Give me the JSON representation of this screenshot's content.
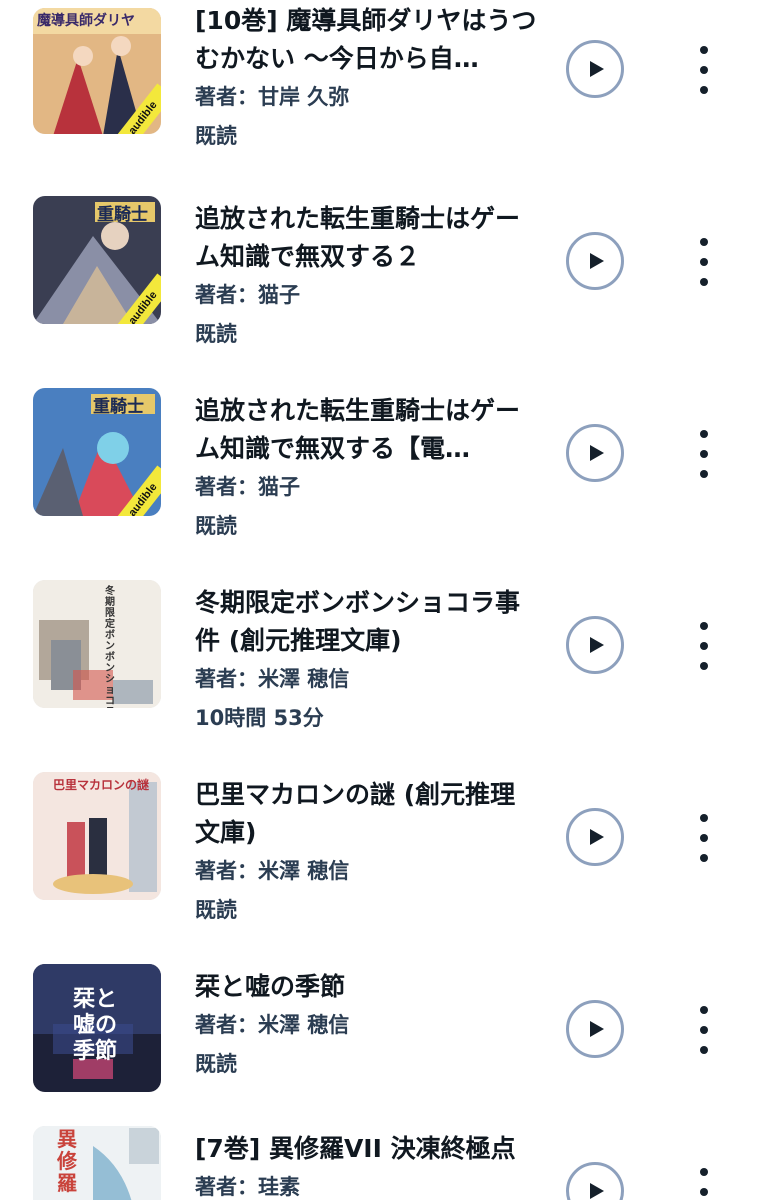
{
  "library": {
    "items": [
      {
        "title": "[10巻] 魔導具師ダリヤはうつむかない ～今日から自…",
        "author": "著者：甘岸 久弥",
        "status": "既読",
        "cover_badge": "audible",
        "cover_title": "魔導具師ダリヤ",
        "cover_colors": [
          "#d9a06a",
          "#b8323c",
          "#2a2f4a"
        ]
      },
      {
        "title": "追放された転生重騎士はゲーム知識で無双する２",
        "author": "著者：猫子",
        "status": "既読",
        "cover_badge": "audible",
        "cover_title": "重騎士",
        "cover_colors": [
          "#3a3e52",
          "#c8b49a",
          "#e6c86a"
        ]
      },
      {
        "title": "追放された転生重騎士はゲーム知識で無双する【電…",
        "author": "著者：猫子",
        "status": "既読",
        "cover_badge": "audible",
        "cover_title": "重騎士",
        "cover_colors": [
          "#4a7fc0",
          "#d94a5a",
          "#7fd0e8"
        ]
      },
      {
        "title": "冬期限定ボンボンショコラ事件 (創元推理文庫)",
        "author": "著者：米澤 穂信",
        "status": "10時間 53分",
        "cover_badge": "",
        "cover_title": "冬期限定ボンボンショコラ事件",
        "cover_colors": [
          "#f1ede6",
          "#b2a79a",
          "#d4574f"
        ]
      },
      {
        "title": "巴里マカロンの謎 (創元推理文庫)",
        "author": "著者：米澤 穂信",
        "status": "既読",
        "cover_badge": "",
        "cover_title": "巴里マカロンの謎",
        "cover_colors": [
          "#f4e6e0",
          "#c9525a",
          "#a0b5c8"
        ]
      },
      {
        "title": "栞と嘘の季節",
        "author": "著者：米澤 穂信",
        "status": "既読",
        "cover_badge": "",
        "cover_title": "栞と嘘の季節",
        "cover_colors": [
          "#1d2138",
          "#2f3a66",
          "#d94a7a"
        ]
      },
      {
        "title": "[7巻] 異修羅VII 決凍終極点",
        "author": "著者：珪素",
        "status": "",
        "cover_badge": "",
        "cover_title": "異修羅",
        "cover_colors": [
          "#eef2f4",
          "#c9433b",
          "#6fa8c7"
        ]
      }
    ]
  },
  "icons": {
    "play": "play-icon",
    "more": "more-vert-icon"
  },
  "colors": {
    "play_ring": "#8da0bd",
    "text": "#101820",
    "meta": "#2b3d52"
  }
}
